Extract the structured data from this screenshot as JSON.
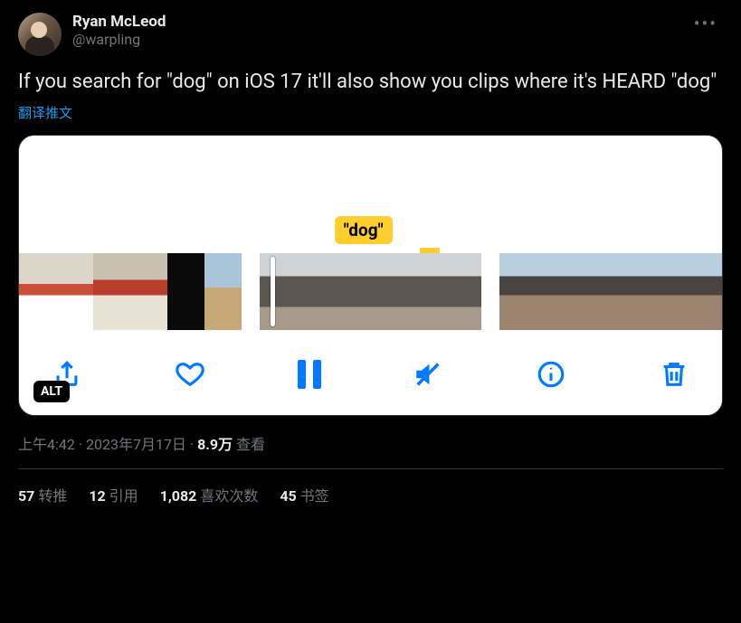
{
  "author": {
    "display_name": "Ryan McLeod",
    "handle": "@warpling"
  },
  "tweet_text": "If you search for \"dog\" on iOS 17 it'll also show you clips where it's HEARD \"dog\"",
  "translate_label": "翻译推文",
  "media": {
    "search_badge": "\"dog\"",
    "alt_label": "ALT",
    "toolbar": {
      "share": "share",
      "like": "like",
      "pause": "pause",
      "mute": "mute",
      "info": "info",
      "delete": "delete"
    }
  },
  "meta": {
    "time": "上午4:42",
    "sep1": " · ",
    "date": "2023年7月17日",
    "sep2": " · ",
    "views_number": "8.9万",
    "views_label": " 查看"
  },
  "stats": {
    "retweets_n": "57",
    "retweets_l": " 转推",
    "quotes_n": "12",
    "quotes_l": " 引用",
    "likes_n": "1,082",
    "likes_l": " 喜欢次数",
    "bookmarks_n": "45",
    "bookmarks_l": " 书签"
  }
}
